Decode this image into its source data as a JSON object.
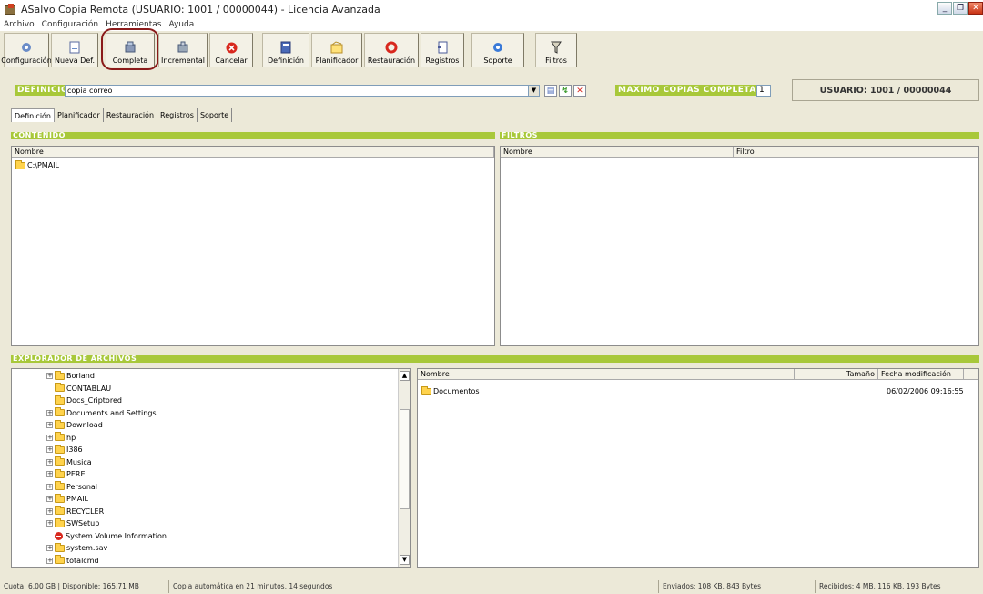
{
  "window": {
    "title": "ASalvo Copia Remota (USUARIO: 1001 / 00000044) - Licencia Avanzada"
  },
  "menu": [
    "Archivo",
    "Configuración",
    "Herramientas",
    "Ayuda"
  ],
  "toolbar": [
    {
      "label": "Configuración",
      "icon": "gear-icon"
    },
    {
      "label": "Nueva Def.",
      "icon": "new-document-icon"
    },
    {
      "label": "Completa",
      "icon": "full-backup-icon"
    },
    {
      "label": "Incremental",
      "icon": "incremental-backup-icon"
    },
    {
      "label": "Cancelar",
      "icon": "cancel-icon"
    },
    {
      "label": "Definición",
      "icon": "definition-icon"
    },
    {
      "label": "Planificador",
      "icon": "scheduler-icon"
    },
    {
      "label": "Restauración",
      "icon": "restore-icon"
    },
    {
      "label": "Registros",
      "icon": "logs-icon"
    },
    {
      "label": "Soporte",
      "icon": "support-icon"
    },
    {
      "label": "Filtros",
      "icon": "filter-icon"
    }
  ],
  "definition": {
    "label": "DEFINICION:",
    "value": "copia correo",
    "max_label": "MAXIMO COPIAS COMPLETAS:",
    "max_value": "1",
    "user": "USUARIO: 1001 / 00000044"
  },
  "tabs": [
    "Definición",
    "Planificador",
    "Restauración",
    "Registros",
    "Soporte"
  ],
  "contenido": {
    "header": "CONTENIDO",
    "col_nombre": "Nombre",
    "items": [
      "C:\\PMAIL"
    ]
  },
  "filtros": {
    "header": "FILTROS",
    "col_nombre": "Nombre",
    "col_filtro": "Filtro"
  },
  "explorer": {
    "header": "EXPLORADOR DE ARCHIVOS",
    "tree": [
      {
        "name": "Borland",
        "expand": true
      },
      {
        "name": "CONTABLAU",
        "expand": false
      },
      {
        "name": "Docs_Criptored",
        "expand": false
      },
      {
        "name": "Documents and Settings",
        "expand": true
      },
      {
        "name": "Download",
        "expand": true
      },
      {
        "name": "hp",
        "expand": true
      },
      {
        "name": "I386",
        "expand": true
      },
      {
        "name": "Musica",
        "expand": true
      },
      {
        "name": "PERE",
        "expand": true
      },
      {
        "name": "Personal",
        "expand": true
      },
      {
        "name": "PMAIL",
        "expand": true
      },
      {
        "name": "RECYCLER",
        "expand": true
      },
      {
        "name": "SWSetup",
        "expand": true
      },
      {
        "name": "System Volume Information",
        "expand": false,
        "special": true
      },
      {
        "name": "system.sav",
        "expand": true
      },
      {
        "name": "totalcmd",
        "expand": true
      }
    ],
    "col_nombre": "Nombre",
    "col_tamano": "Tamaño",
    "col_fecha": "Fecha modificación",
    "files": [
      {
        "name": "Documentos",
        "size": "",
        "date": "06/02/2006 09:16:55"
      }
    ]
  },
  "status": {
    "cuota": "Cuota: 6.00 GB | Disponible: 165.71 MB",
    "next": "Copia automática en 21 minutos, 14 segundos",
    "enviados": "Enviados: 108 KB, 843 Bytes",
    "recibidos": "Recibidos: 4 MB, 116 KB, 193 Bytes"
  },
  "colors": {
    "accent_green": "#a8c83a",
    "highlight_circle": "#8a1a1a"
  }
}
